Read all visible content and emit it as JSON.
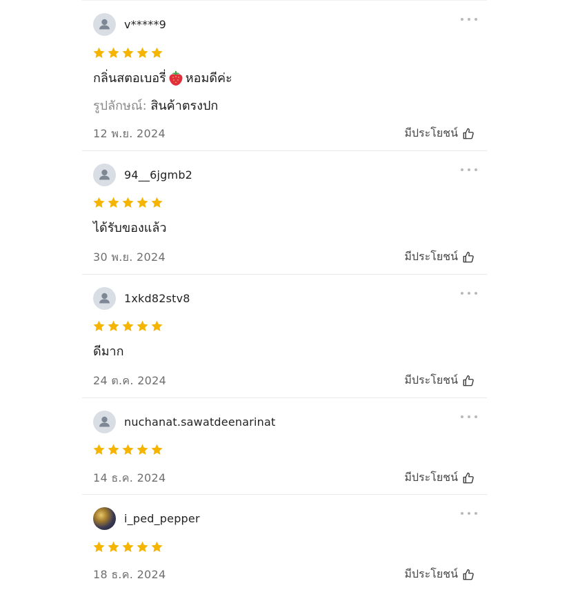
{
  "reviews": [
    {
      "username": "v*****9",
      "rating": 5,
      "comment_before": "กลิ่นสตอเบอรี่",
      "comment_emoji": "strawberry-emoji",
      "comment_after": "หอมดีค่ะ",
      "attribute_label": "รูปลักษณ์:",
      "attribute_value": "สินค้าตรงปก",
      "date": "12 พ.ย. 2024",
      "helpful_label": "มีประโยชน์"
    },
    {
      "username": "94__6jgmb2",
      "rating": 5,
      "comment": "ได้รับของแล้ว",
      "date": "30 พ.ย. 2024",
      "helpful_label": "มีประโยชน์"
    },
    {
      "username": "1xkd82stv8",
      "rating": 5,
      "comment": "ดีมาก",
      "date": "24 ต.ค. 2024",
      "helpful_label": "มีประโยชน์"
    },
    {
      "username": "nuchanat.sawatdeenarinat",
      "rating": 5,
      "date": "14 ธ.ค. 2024",
      "helpful_label": "มีประโยชน์"
    },
    {
      "username": "i_ped_pepper",
      "rating": 5,
      "date": "18 ธ.ค. 2024",
      "helpful_label": "มีประโยชน์"
    }
  ],
  "icons": {
    "star_color": "#F5B400",
    "more": "more-options-icon",
    "helpful": "thumbs-up-icon",
    "avatar": "user-avatar-icon"
  }
}
